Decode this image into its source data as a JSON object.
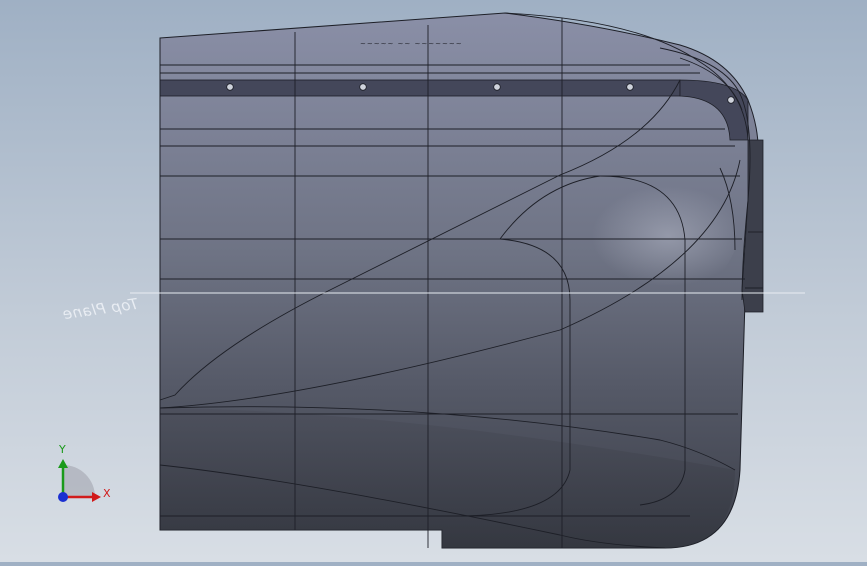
{
  "viewport": {
    "plane_label": "Top Plane",
    "triad": {
      "x_label": "X",
      "y_label": "Y"
    },
    "colors": {
      "background_top": "#9fb0c4",
      "background_bottom": "#d8dee5",
      "part_top": "#8a8fa7",
      "part_bottom": "#3b3e48",
      "edge": "#1d1f27",
      "axis_x": "#d11a1a",
      "axis_y": "#1a9a1a",
      "axis_z": "#1a2fd1"
    },
    "icons": [
      "triad-x-arrow-icon",
      "triad-y-arrow-icon",
      "triad-origin-icon"
    ]
  }
}
